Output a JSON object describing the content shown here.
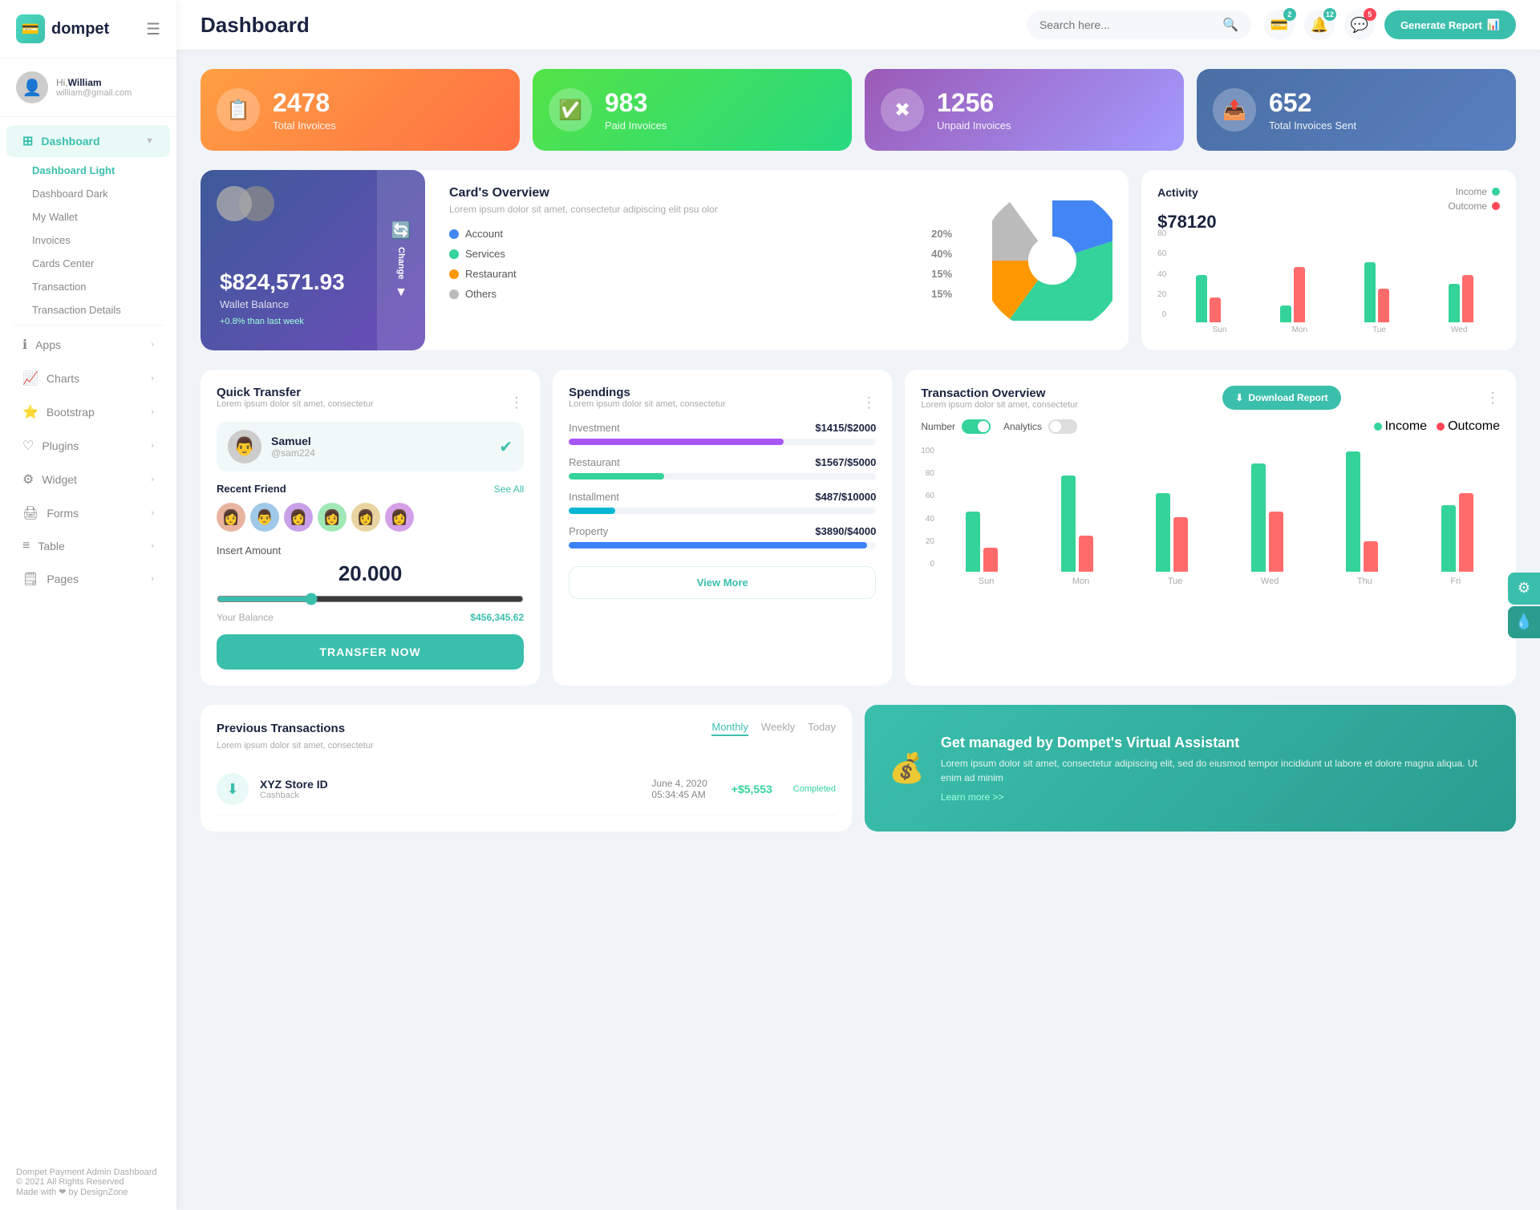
{
  "app": {
    "name": "dompet",
    "tagline": "Dompet Payment Admin Dashboard",
    "copyright": "© 2021 All Rights Reserved",
    "made_with": "Made with ❤ by DesignZone"
  },
  "header": {
    "title": "Dashboard",
    "search_placeholder": "Search here...",
    "generate_btn": "Generate Report",
    "badges": {
      "wallet": "2",
      "bell": "12",
      "chat": "5"
    }
  },
  "user": {
    "greeting": "Hi,",
    "name": "William",
    "email": "william@gmail.com"
  },
  "sidebar": {
    "nav_items": [
      {
        "label": "Dashboard",
        "icon": "⊞",
        "active": true,
        "has_arrow": true
      },
      {
        "label": "Apps",
        "icon": "ℹ",
        "has_arrow": true
      },
      {
        "label": "Charts",
        "icon": "📈",
        "has_arrow": true
      },
      {
        "label": "Bootstrap",
        "icon": "⭐",
        "has_arrow": true
      },
      {
        "label": "Plugins",
        "icon": "❤",
        "has_arrow": true
      },
      {
        "label": "Widget",
        "icon": "⚙",
        "has_arrow": true
      },
      {
        "label": "Forms",
        "icon": "🖨",
        "has_arrow": true
      },
      {
        "label": "Table",
        "icon": "≡",
        "has_arrow": true
      },
      {
        "label": "Pages",
        "icon": "🗒",
        "has_arrow": true
      }
    ],
    "sub_items": [
      {
        "label": "Dashboard Light",
        "active": true
      },
      {
        "label": "Dashboard Dark"
      },
      {
        "label": "My Wallet"
      },
      {
        "label": "Invoices"
      },
      {
        "label": "Cards Center"
      },
      {
        "label": "Transaction"
      },
      {
        "label": "Transaction Details"
      }
    ]
  },
  "stat_cards": [
    {
      "number": "2478",
      "label": "Total Invoices",
      "color": "orange",
      "icon": "📋"
    },
    {
      "number": "983",
      "label": "Paid Invoices",
      "color": "green",
      "icon": "✅"
    },
    {
      "number": "1256",
      "label": "Unpaid Invoices",
      "color": "purple",
      "icon": "✖"
    },
    {
      "number": "652",
      "label": "Total Invoices Sent",
      "color": "teal",
      "icon": "📤"
    }
  ],
  "wallet_card": {
    "balance": "$824,571.93",
    "label": "Wallet Balance",
    "change": "+0.8% than last week",
    "change_btn": "Change"
  },
  "card_overview": {
    "title": "Card's Overview",
    "subtitle": "Lorem ipsum dolor sit amet, consectetur adipiscing elit psu olor",
    "items": [
      {
        "label": "Account",
        "pct": "20%",
        "color": "blue"
      },
      {
        "label": "Services",
        "pct": "40%",
        "color": "green"
      },
      {
        "label": "Restaurant",
        "pct": "15%",
        "color": "orange"
      },
      {
        "label": "Others",
        "pct": "15%",
        "color": "gray"
      }
    ]
  },
  "activity": {
    "title": "Activity",
    "amount": "$78120",
    "income_label": "Income",
    "outcome_label": "Outcome",
    "bars": [
      {
        "day": "Sun",
        "income": 55,
        "outcome": 30
      },
      {
        "day": "Mon",
        "income": 20,
        "outcome": 65
      },
      {
        "day": "Tue",
        "income": 70,
        "outcome": 40
      },
      {
        "day": "Wed",
        "income": 45,
        "outcome": 55
      }
    ]
  },
  "quick_transfer": {
    "title": "Quick Transfer",
    "subtitle": "Lorem ipsum dolor sit amet, consectetur",
    "user": {
      "name": "Samuel",
      "handle": "@sam224"
    },
    "recent_label": "Recent Friend",
    "see_all": "See All",
    "insert_label": "Insert Amount",
    "amount": "20.000",
    "balance_label": "Your Balance",
    "balance": "$456,345.62",
    "btn": "TRANSFER NOW"
  },
  "spendings": {
    "title": "Spendings",
    "subtitle": "Lorem ipsum dolor sit amet, consectetur",
    "items": [
      {
        "label": "Investment",
        "amount": "$1415",
        "max": "$2000",
        "pct": 70,
        "color": "fill-purple"
      },
      {
        "label": "Restaurant",
        "amount": "$1567",
        "max": "$5000",
        "pct": 31,
        "color": "fill-green"
      },
      {
        "label": "Installment",
        "amount": "$487",
        "max": "$10000",
        "pct": 15,
        "color": "fill-cyan"
      },
      {
        "label": "Property",
        "amount": "$3890",
        "max": "$4000",
        "pct": 97,
        "color": "fill-blue"
      }
    ],
    "view_more": "View More"
  },
  "transaction_overview": {
    "title": "Transaction Overview",
    "subtitle": "Lorem ipsum dolor sit amet, consectetur",
    "download_btn": "Download Report",
    "number_label": "Number",
    "analytics_label": "Analytics",
    "income_label": "Income",
    "outcome_label": "Outcome",
    "y_labels": [
      "100",
      "80",
      "60",
      "40",
      "20",
      "0"
    ],
    "x_labels": [
      "Sun",
      "Mon",
      "Tue",
      "Wed",
      "Thu",
      "Fri"
    ],
    "bars": [
      {
        "income": 50,
        "outcome": 20
      },
      {
        "income": 80,
        "outcome": 30
      },
      {
        "income": 65,
        "outcome": 45
      },
      {
        "income": 90,
        "outcome": 50
      },
      {
        "income": 100,
        "outcome": 25
      },
      {
        "income": 55,
        "outcome": 65
      }
    ]
  },
  "prev_transactions": {
    "title": "Previous Transactions",
    "subtitle": "Lorem ipsum dolor sit amet, consectetur",
    "tabs": [
      "Monthly",
      "Weekly",
      "Today"
    ],
    "active_tab": "Monthly",
    "items": [
      {
        "name": "XYZ Store ID",
        "type": "Cashback",
        "date": "June 4, 2020",
        "time": "05:34:45 AM",
        "amount": "+$5,553",
        "status": "Completed",
        "icon": "⬇"
      }
    ]
  },
  "va_banner": {
    "title": "Get managed by Dompet's Virtual Assistant",
    "text": "Lorem ipsum dolor sit amet, consectetur adipiscing elit, sed do eiusmod tempor incididunt ut labore et dolore magna aliqua. Ut enim ad minim",
    "learn_more": "Learn more >>"
  },
  "pie_chart": {
    "segments": [
      {
        "label": "Account",
        "pct": 20,
        "color": "#4285f4"
      },
      {
        "label": "Services",
        "pct": 40,
        "color": "#34d399"
      },
      {
        "label": "Restaurant",
        "pct": 15,
        "color": "#ff9800"
      },
      {
        "label": "Others",
        "pct": 15,
        "color": "#bbb"
      }
    ]
  }
}
